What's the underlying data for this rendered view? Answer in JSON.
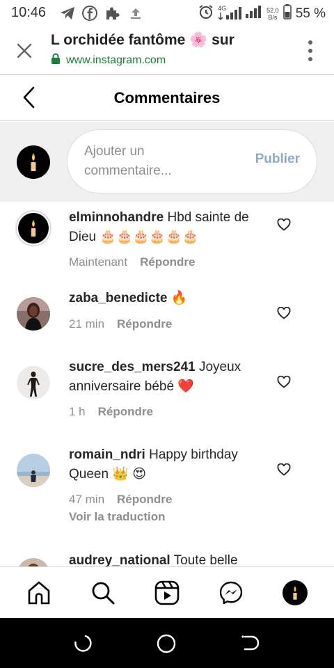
{
  "status_bar": {
    "time": "10:46",
    "network_label": "4G",
    "speed_value": "52.0",
    "speed_unit": "B/s",
    "battery": "55 %"
  },
  "browser": {
    "title": "L orchidée fantôme 🌸 sur",
    "url": "www.instagram.com"
  },
  "page": {
    "title": "Commentaires"
  },
  "composer": {
    "placeholder": "Ajouter un commentaire...",
    "publish_label": "Publier"
  },
  "comments": [
    {
      "username": "elminnohandre",
      "text": "Hbd sainte de Dieu 🎂🎂🎂🎂🎂🎂",
      "time": "Maintenant",
      "reply_label": "Répondre"
    },
    {
      "username": "zaba_benedicte",
      "text": "🔥",
      "time": "21 min",
      "reply_label": "Répondre"
    },
    {
      "username": "sucre_des_mers241",
      "text": "Joyeux anniversaire bébé ❤️",
      "time": "1 h",
      "reply_label": "Répondre"
    },
    {
      "username": "romain_ndri",
      "text": "Happy birthday Queen 👑 😍",
      "time": "47 min",
      "reply_label": "Répondre",
      "translate_label": "Voir la traduction"
    },
    {
      "username": "audrey_national",
      "text": "Toute belle"
    }
  ],
  "icons": {
    "status": [
      "telegram-icon",
      "facebook-icon",
      "puzzle-icon",
      "upload-icon",
      "alarm-icon",
      "signal-icon",
      "battery-icon"
    ],
    "nav": [
      "home-icon",
      "search-icon",
      "reels-icon",
      "messenger-icon",
      "profile-avatar"
    ],
    "system": [
      "recents-icon",
      "home-circle-icon",
      "back-icon"
    ]
  },
  "colors": {
    "accent_green": "#1a7f37",
    "publish_disabled": "#8fa8c4",
    "secondary_text": "#8e8e8e"
  }
}
